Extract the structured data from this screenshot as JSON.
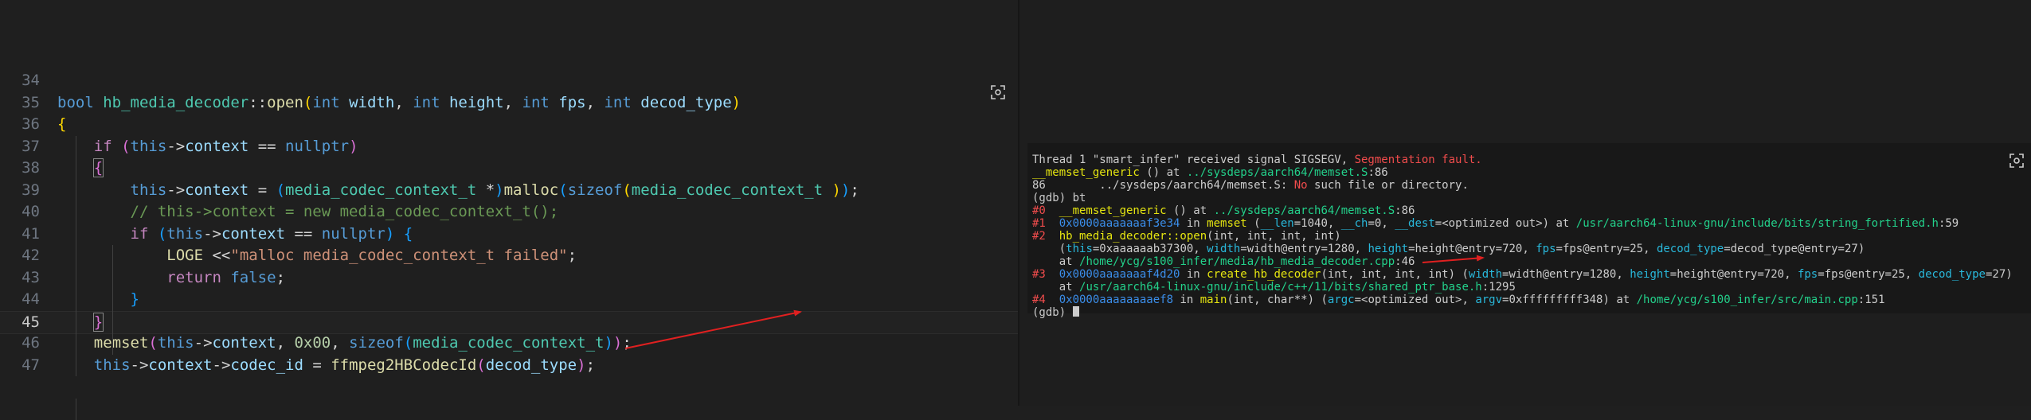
{
  "editor": {
    "lines": [
      {
        "num": "34",
        "tokens": []
      },
      {
        "num": "35",
        "tokens": [
          {
            "t": "bool ",
            "c": "kw"
          },
          {
            "t": "hb_media_decoder",
            "c": "type"
          },
          {
            "t": "::",
            "c": ""
          },
          {
            "t": "open",
            "c": "fn"
          },
          {
            "t": "(",
            "c": "b1"
          },
          {
            "t": "int ",
            "c": "kw"
          },
          {
            "t": "width",
            "c": "var"
          },
          {
            "t": ", ",
            "c": ""
          },
          {
            "t": "int ",
            "c": "kw"
          },
          {
            "t": "height",
            "c": "var"
          },
          {
            "t": ", ",
            "c": ""
          },
          {
            "t": "int ",
            "c": "kw"
          },
          {
            "t": "fps",
            "c": "var"
          },
          {
            "t": ", ",
            "c": ""
          },
          {
            "t": "int ",
            "c": "kw"
          },
          {
            "t": "decod_type",
            "c": "var"
          },
          {
            "t": ")",
            "c": "b1"
          }
        ]
      },
      {
        "num": "36",
        "tokens": [
          {
            "t": "{",
            "c": "b1"
          }
        ]
      },
      {
        "num": "37",
        "tokens": [
          {
            "t": "    ",
            "c": ""
          },
          {
            "t": "if ",
            "c": "ctl"
          },
          {
            "t": "(",
            "c": "b2"
          },
          {
            "t": "this",
            "c": "kw"
          },
          {
            "t": "->",
            "c": ""
          },
          {
            "t": "context",
            "c": "var"
          },
          {
            "t": " == ",
            "c": ""
          },
          {
            "t": "nullptr",
            "c": "kw"
          },
          {
            "t": ")",
            "c": "b2"
          }
        ]
      },
      {
        "num": "38",
        "tokens": [
          {
            "t": "    ",
            "c": ""
          },
          {
            "t": "{",
            "c": "b2 bracket-box"
          }
        ]
      },
      {
        "num": "39",
        "tokens": [
          {
            "t": "        ",
            "c": ""
          },
          {
            "t": "this",
            "c": "kw"
          },
          {
            "t": "->",
            "c": ""
          },
          {
            "t": "context",
            "c": "var"
          },
          {
            "t": " = ",
            "c": ""
          },
          {
            "t": "(",
            "c": "b3"
          },
          {
            "t": "media_codec_context_t ",
            "c": "type"
          },
          {
            "t": "*",
            "c": ""
          },
          {
            "t": ")",
            "c": "b3"
          },
          {
            "t": "malloc",
            "c": "fn"
          },
          {
            "t": "(",
            "c": "b3"
          },
          {
            "t": "sizeof",
            "c": "kw"
          },
          {
            "t": "(",
            "c": "b1"
          },
          {
            "t": "media_codec_context_t ",
            "c": "type"
          },
          {
            "t": ")",
            "c": "b1"
          },
          {
            "t": ")",
            "c": "b3"
          },
          {
            "t": ";",
            "c": ""
          }
        ]
      },
      {
        "num": "40",
        "tokens": [
          {
            "t": "        ",
            "c": ""
          },
          {
            "t": "// this->context = new media_codec_context_t();",
            "c": "cmt"
          }
        ]
      },
      {
        "num": "41",
        "tokens": [
          {
            "t": "        ",
            "c": ""
          },
          {
            "t": "if ",
            "c": "ctl"
          },
          {
            "t": "(",
            "c": "b3"
          },
          {
            "t": "this",
            "c": "kw"
          },
          {
            "t": "->",
            "c": ""
          },
          {
            "t": "context",
            "c": "var"
          },
          {
            "t": " == ",
            "c": ""
          },
          {
            "t": "nullptr",
            "c": "kw"
          },
          {
            "t": ")",
            "c": "b3"
          },
          {
            "t": " ",
            "c": ""
          },
          {
            "t": "{",
            "c": "b3"
          }
        ]
      },
      {
        "num": "42",
        "tokens": [
          {
            "t": "            ",
            "c": ""
          },
          {
            "t": "LOGE ",
            "c": "fn"
          },
          {
            "t": "<<",
            "c": ""
          },
          {
            "t": "\"malloc media_codec_context_t failed\"",
            "c": "str"
          },
          {
            "t": ";",
            "c": ""
          }
        ]
      },
      {
        "num": "43",
        "tokens": [
          {
            "t": "            ",
            "c": ""
          },
          {
            "t": "return ",
            "c": "ctl"
          },
          {
            "t": "false",
            "c": "kw"
          },
          {
            "t": ";",
            "c": ""
          }
        ]
      },
      {
        "num": "44",
        "tokens": [
          {
            "t": "        ",
            "c": ""
          },
          {
            "t": "}",
            "c": "b3"
          }
        ]
      },
      {
        "num": "45",
        "tokens": [
          {
            "t": "    ",
            "c": ""
          },
          {
            "t": "}",
            "c": "b2 bracket-box"
          }
        ]
      },
      {
        "num": "46",
        "tokens": [
          {
            "t": "    ",
            "c": ""
          },
          {
            "t": "memset",
            "c": "fn"
          },
          {
            "t": "(",
            "c": "b2"
          },
          {
            "t": "this",
            "c": "kw"
          },
          {
            "t": "->",
            "c": ""
          },
          {
            "t": "context",
            "c": "var"
          },
          {
            "t": ", ",
            "c": ""
          },
          {
            "t": "0x00",
            "c": "num"
          },
          {
            "t": ", ",
            "c": ""
          },
          {
            "t": "sizeof",
            "c": "kw"
          },
          {
            "t": "(",
            "c": "b3"
          },
          {
            "t": "media_codec_context_t",
            "c": "type"
          },
          {
            "t": ")",
            "c": "b3"
          },
          {
            "t": ")",
            "c": "b2"
          },
          {
            "t": ";",
            "c": ""
          }
        ]
      },
      {
        "num": "47",
        "tokens": [
          {
            "t": "    ",
            "c": ""
          },
          {
            "t": "this",
            "c": "kw"
          },
          {
            "t": "->",
            "c": ""
          },
          {
            "t": "context",
            "c": "var"
          },
          {
            "t": "->",
            "c": ""
          },
          {
            "t": "codec_id",
            "c": "var"
          },
          {
            "t": " = ",
            "c": ""
          },
          {
            "t": "ffmpeg2HBCodecId",
            "c": "fn"
          },
          {
            "t": "(",
            "c": "b2"
          },
          {
            "t": "decod_type",
            "c": "var"
          },
          {
            "t": ")",
            "c": "b2"
          },
          {
            "t": ";",
            "c": ""
          }
        ]
      }
    ],
    "focus_icon": "fullscreen-focus-icon"
  },
  "terminal": {
    "focus_icon": "fullscreen-focus-icon",
    "lines": [
      [
        {
          "t": "Thread 1 \"smart_infer\" received signal SIGSEGV, ",
          "c": ""
        },
        {
          "t": "Segmentation fault.",
          "c": "t-red"
        }
      ],
      [
        {
          "t": "__memset_generic",
          "c": "t-yellow"
        },
        {
          "t": " () at ",
          "c": ""
        },
        {
          "t": "../sysdeps/aarch64/memset.S",
          "c": "t-green"
        },
        {
          "t": ":86",
          "c": ""
        }
      ],
      [
        {
          "t": "86        ../sysdeps/aarch64/memset.S: ",
          "c": ""
        },
        {
          "t": "No",
          "c": "t-red"
        },
        {
          "t": " such file or directory.",
          "c": ""
        }
      ],
      [
        {
          "t": "(gdb) bt",
          "c": ""
        }
      ],
      [
        {
          "t": "#0  ",
          "c": "t-red"
        },
        {
          "t": "__memset_generic",
          "c": "t-yellow"
        },
        {
          "t": " () at ",
          "c": ""
        },
        {
          "t": "../sysdeps/aarch64/memset.S",
          "c": "t-green"
        },
        {
          "t": ":86",
          "c": ""
        }
      ],
      [
        {
          "t": "#1  ",
          "c": "t-red"
        },
        {
          "t": "0x0000aaaaaaaf3e34",
          "c": "t-blue"
        },
        {
          "t": " in ",
          "c": ""
        },
        {
          "t": "memset",
          "c": "t-yellow"
        },
        {
          "t": " (",
          "c": ""
        },
        {
          "t": "__len",
          "c": "t-cyan"
        },
        {
          "t": "=1040, ",
          "c": ""
        },
        {
          "t": "__ch",
          "c": "t-cyan"
        },
        {
          "t": "=0, ",
          "c": ""
        },
        {
          "t": "__dest",
          "c": "t-cyan"
        },
        {
          "t": "=<optimized out>) at ",
          "c": ""
        },
        {
          "t": "/usr/aarch64-linux-gnu/include/bits/string_fortified.h",
          "c": "t-green"
        },
        {
          "t": ":59",
          "c": ""
        }
      ],
      [
        {
          "t": "#2  ",
          "c": "t-red"
        },
        {
          "t": "hb_media_decoder::open",
          "c": "t-yellow"
        },
        {
          "t": "(int, int, int, int)",
          "c": ""
        }
      ],
      [
        {
          "t": "    (",
          "c": ""
        },
        {
          "t": "this",
          "c": "t-cyan"
        },
        {
          "t": "=0xaaaaaab37300, ",
          "c": ""
        },
        {
          "t": "width",
          "c": "t-cyan"
        },
        {
          "t": "=width@entry=1280, ",
          "c": ""
        },
        {
          "t": "height",
          "c": "t-cyan"
        },
        {
          "t": "=height@entry=720, ",
          "c": ""
        },
        {
          "t": "fps",
          "c": "t-cyan"
        },
        {
          "t": "=fps@entry=25, ",
          "c": ""
        },
        {
          "t": "decod_type",
          "c": "t-cyan"
        },
        {
          "t": "=decod_type@entry=27)",
          "c": ""
        }
      ],
      [
        {
          "t": "    at ",
          "c": ""
        },
        {
          "t": "/home/ycg/s100_infer/media/hb_media_decoder.cpp",
          "c": "t-green"
        },
        {
          "t": ":46",
          "c": ""
        }
      ],
      [
        {
          "t": "#3  ",
          "c": "t-red"
        },
        {
          "t": "0x0000aaaaaaaf4d20",
          "c": "t-blue"
        },
        {
          "t": " in ",
          "c": ""
        },
        {
          "t": "create_hb_decoder",
          "c": "t-yellow"
        },
        {
          "t": "(int, int, int, int) (",
          "c": ""
        },
        {
          "t": "width",
          "c": "t-cyan"
        },
        {
          "t": "=width@entry=1280, ",
          "c": ""
        },
        {
          "t": "height",
          "c": "t-cyan"
        },
        {
          "t": "=height@entry=720, ",
          "c": ""
        },
        {
          "t": "fps",
          "c": "t-cyan"
        },
        {
          "t": "=fps@entry=25, ",
          "c": ""
        },
        {
          "t": "decod_type",
          "c": "t-cyan"
        },
        {
          "t": "=27)",
          "c": ""
        }
      ],
      [
        {
          "t": "    at ",
          "c": ""
        },
        {
          "t": "/usr/aarch64-linux-gnu/include/c++/11/bits/shared_ptr_base.h",
          "c": "t-green"
        },
        {
          "t": ":1295",
          "c": ""
        }
      ],
      [
        {
          "t": "#4  ",
          "c": "t-red"
        },
        {
          "t": "0x0000aaaaaaaaef8",
          "c": "t-blue"
        },
        {
          "t": " in ",
          "c": ""
        },
        {
          "t": "main",
          "c": "t-yellow"
        },
        {
          "t": "(int, char**) (",
          "c": ""
        },
        {
          "t": "argc",
          "c": "t-cyan"
        },
        {
          "t": "=<optimized out>, ",
          "c": ""
        },
        {
          "t": "argv",
          "c": "t-cyan"
        },
        {
          "t": "=0xfffffffff348) at ",
          "c": ""
        },
        {
          "t": "/home/ycg/s100_infer/src/main.cpp",
          "c": "t-green"
        },
        {
          "t": ":151",
          "c": ""
        }
      ],
      [
        {
          "t": "(gdb) ",
          "c": ""
        }
      ]
    ]
  },
  "colors": {
    "annotation_arrow": "#e02020",
    "editor_bg": "#1f1f1f",
    "terminal_bg": "#181818"
  }
}
